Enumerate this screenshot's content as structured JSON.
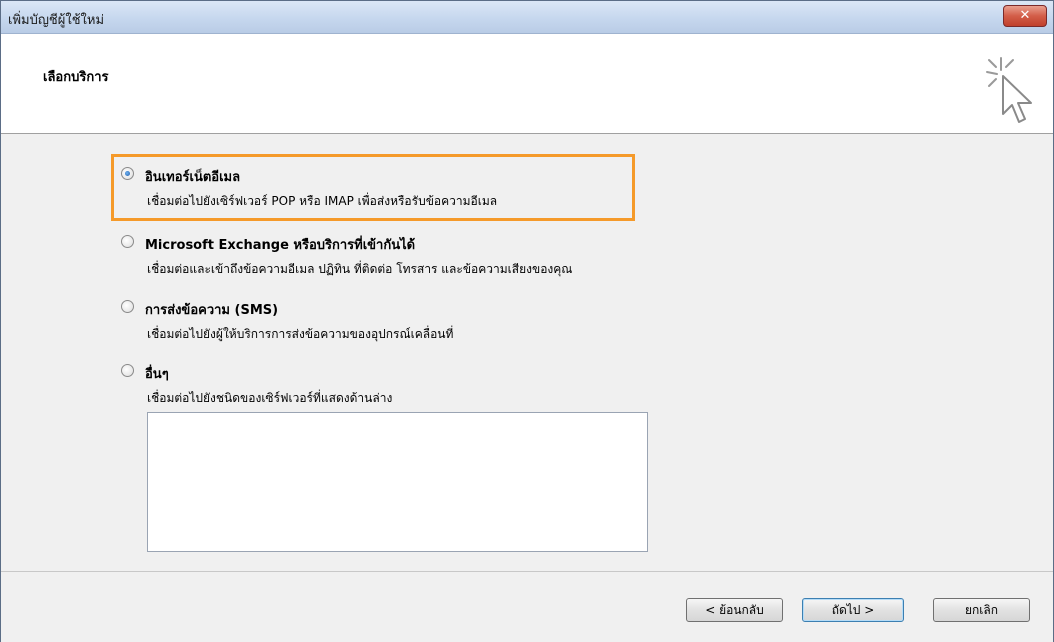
{
  "window": {
    "title": "เพิ่มบัญชีผู้ใช้ใหม่",
    "close_glyph": "✕",
    "close_color": "#c0402c"
  },
  "header": {
    "title": "เลือกบริการ",
    "icon": "wizard-cursor-icon"
  },
  "options": [
    {
      "label": "อินเทอร์เน็ตอีเมล",
      "description": "เชื่อมต่อไปยังเซิร์ฟเวอร์ POP หรือ IMAP เพื่อส่งหรือรับข้อความอีเมล",
      "selected": true
    },
    {
      "label": "Microsoft Exchange หรือบริการที่เข้ากันได้",
      "description": "เชื่อมต่อและเข้าถึงข้อความอีเมล ปฏิทิน ที่ติดต่อ โทรสาร และข้อความเสียงของคุณ",
      "selected": false
    },
    {
      "label": "การส่งข้อความ (SMS)",
      "description": "เชื่อมต่อไปยังผู้ให้บริการการส่งข้อความของอุปกรณ์เคลื่อนที่",
      "selected": false
    },
    {
      "label": "อื่นๆ",
      "description": "เชื่อมต่อไปยังชนิดของเซิร์ฟเวอร์ที่แสดงด้านล่าง",
      "selected": false
    }
  ],
  "highlight_color": "#f59a2a",
  "footer": {
    "back_label": "< ย้อนกลับ",
    "next_label": "ถัดไป >",
    "cancel_label": "ยกเลิก"
  }
}
